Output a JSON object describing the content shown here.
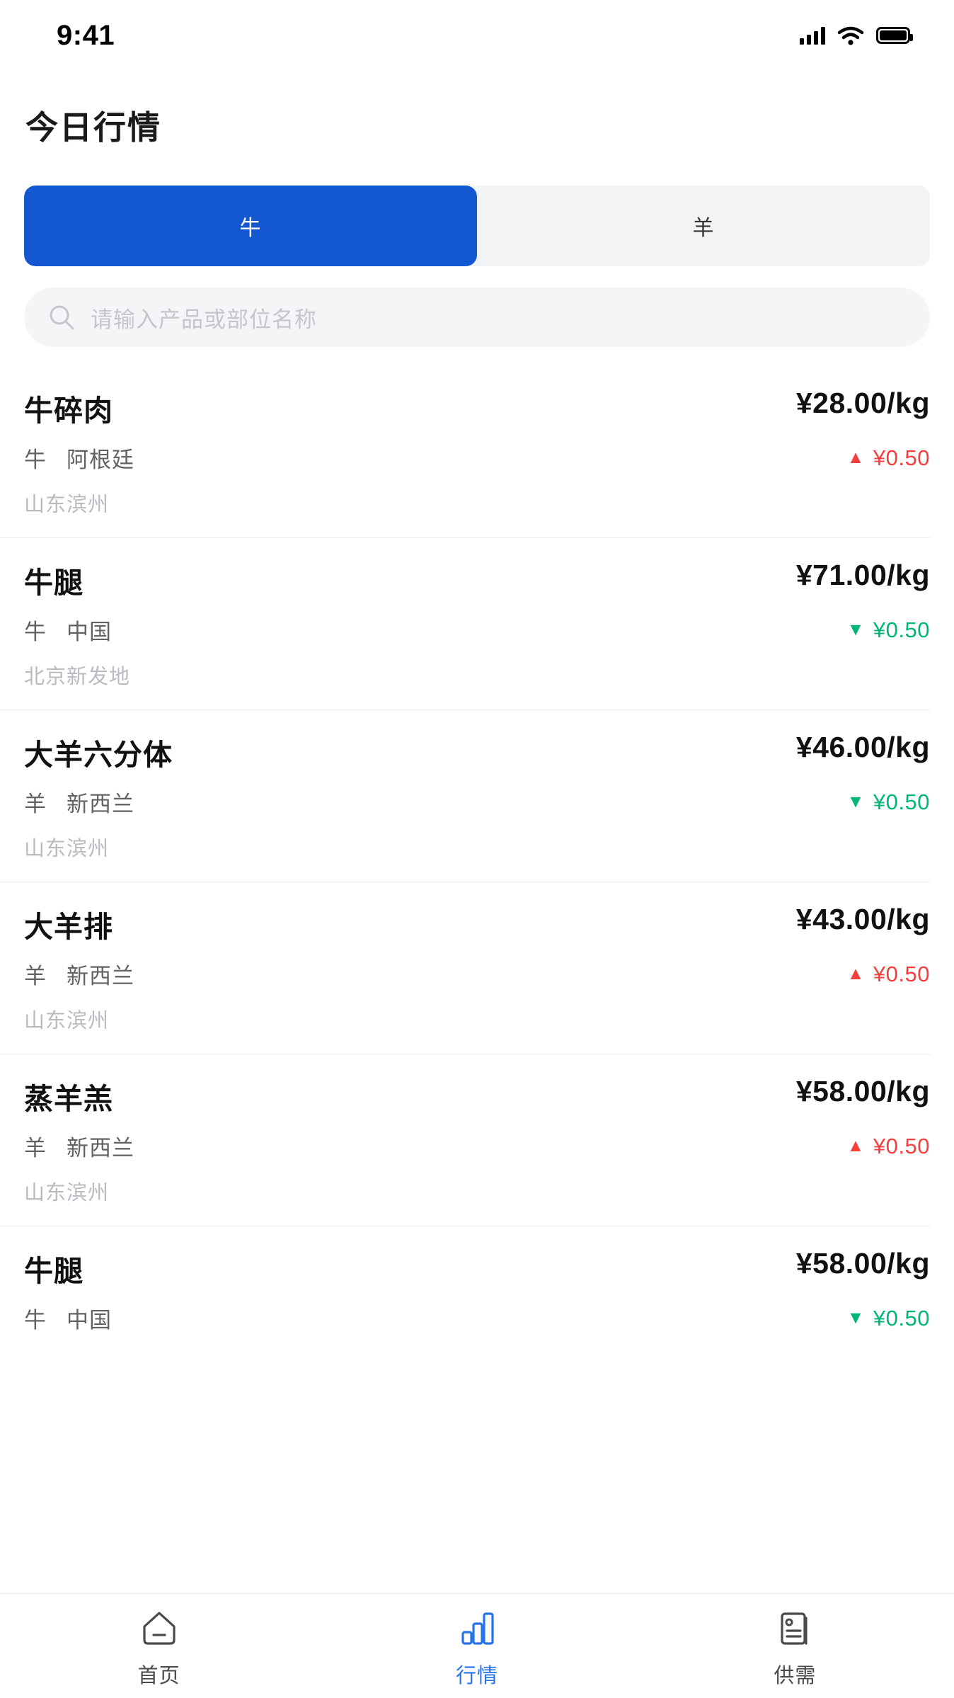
{
  "statusbar": {
    "time": "9:41",
    "icons": [
      "signal-icon",
      "wifi-icon",
      "battery-icon"
    ]
  },
  "header": {
    "title": "今日行情"
  },
  "tabs": {
    "items": [
      {
        "label": "牛",
        "active": true
      },
      {
        "label": "羊",
        "active": false
      }
    ]
  },
  "search": {
    "placeholder": "请输入产品或部位名称",
    "value": "",
    "icon": "search-icon"
  },
  "colors": {
    "accent": "#1358d1",
    "tab_active": "#2672e8",
    "up": "#f53f3f",
    "down": "#00b578",
    "segment_bg": "#f2f3f5",
    "search_bg": "#f4f5f7"
  },
  "list": {
    "rows": [
      {
        "name": "牛碎肉",
        "category": "牛",
        "origin": "阿根廷",
        "location": "山东滨州",
        "price": "¥28.00/kg",
        "change": "¥0.50",
        "direction": "up",
        "arrow": "▲"
      },
      {
        "name": "牛腿",
        "category": "牛",
        "origin": "中国",
        "location": "北京新发地",
        "price": "¥71.00/kg",
        "change": "¥0.50",
        "direction": "down",
        "arrow": "▼"
      },
      {
        "name": "大羊六分体",
        "category": "羊",
        "origin": "新西兰",
        "location": "山东滨州",
        "price": "¥46.00/kg",
        "change": "¥0.50",
        "direction": "down",
        "arrow": "▼"
      },
      {
        "name": "大羊排",
        "category": "羊",
        "origin": "新西兰",
        "location": "山东滨州",
        "price": "¥43.00/kg",
        "change": "¥0.50",
        "direction": "up",
        "arrow": "▲"
      },
      {
        "name": "蒸羊羔",
        "category": "羊",
        "origin": "新西兰",
        "location": "山东滨州",
        "price": "¥58.00/kg",
        "change": "¥0.50",
        "direction": "up",
        "arrow": "▲"
      },
      {
        "name": "牛腿",
        "category": "牛",
        "origin": "中国",
        "location": "",
        "price": "¥58.00/kg",
        "change": "¥0.50",
        "direction": "down",
        "arrow": "▼"
      }
    ]
  },
  "tabbar": {
    "items": [
      {
        "label": "首页",
        "icon": "home-icon",
        "active": false
      },
      {
        "label": "行情",
        "icon": "bar-chart-icon",
        "active": true
      },
      {
        "label": "供需",
        "icon": "document-icon",
        "active": false
      }
    ]
  }
}
